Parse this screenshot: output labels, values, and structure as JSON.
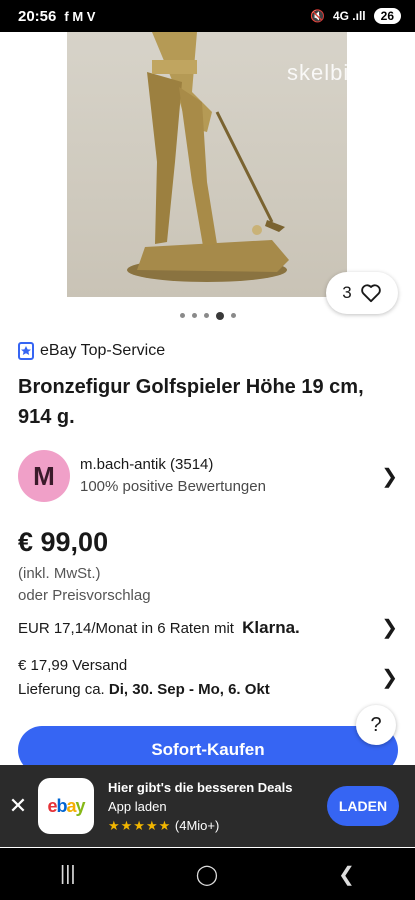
{
  "status_bar": {
    "time": "20:56",
    "left_icons": "f M V",
    "signal": "4G .ıll",
    "battery": "26"
  },
  "hero": {
    "watermark": "skelbiu.lt",
    "favorites_count": "3"
  },
  "carousel": {
    "dots": 5,
    "active_index": 3
  },
  "badge": {
    "label": "eBay Top-Service"
  },
  "listing": {
    "title": "Bronzefigur Golfspieler Höhe 19 cm, 914 g."
  },
  "seller": {
    "avatar_letter": "M",
    "name": "m.bach-antik (3514)",
    "rating": "100% positive Bewertungen"
  },
  "price": {
    "amount": "€ 99,00",
    "vat": "(inkl. MwSt.)",
    "offer": "oder Preisvorschlag"
  },
  "financing": {
    "text": "EUR 17,14/Monat in 6 Raten mit",
    "provider": "Klarna."
  },
  "shipping": {
    "cost": "€ 17,99 Versand",
    "delivery_prefix": "Lieferung ca.",
    "delivery_dates": "Di, 30. Sep - Mo, 6. Okt"
  },
  "help_label": "?",
  "buy_button": "Sofort-Kaufen",
  "app_banner": {
    "headline": "Hier gibt's die besseren Deals",
    "subline": "App laden",
    "stars": "★★★★★",
    "reviews": "(4Mio+)",
    "button": "LADEN",
    "app_logo": "ebay"
  },
  "colors": {
    "accent": "#3665f3",
    "banner_bg": "#2b2b2b",
    "avatar_bg": "#f0a0c8"
  }
}
